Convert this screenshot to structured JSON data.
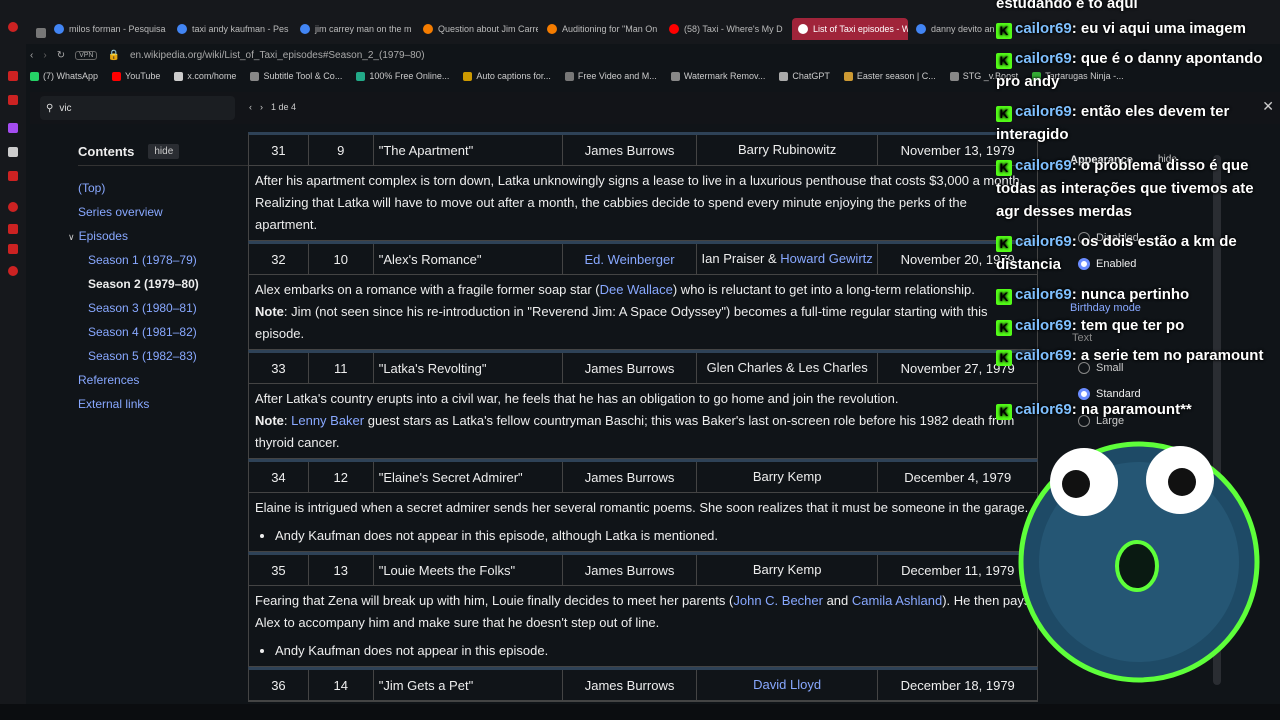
{
  "tabs": [
    {
      "title": "milos forman - Pesquisa",
      "color": "#4285f4"
    },
    {
      "title": "taxi andy kaufman - Pes",
      "color": "#4285f4"
    },
    {
      "title": "jim carrey man on the m",
      "color": "#4285f4"
    },
    {
      "title": "Question about Jim Carre",
      "color": "#f57c00"
    },
    {
      "title": "Auditioning for \"Man On",
      "color": "#f57c00"
    },
    {
      "title": "(58) Taxi - Where's My D",
      "color": "#ff0000"
    },
    {
      "title": "List of Taxi episodes - Wi",
      "color": "#ffffff"
    },
    {
      "title": "danny devito an",
      "color": "#4285f4"
    }
  ],
  "address": {
    "vpn": "VPN",
    "url": "en.wikipedia.org/wiki/List_of_Taxi_episodes#Season_2_(1979–80)"
  },
  "bookmarks": [
    "(7) WhatsApp",
    "YouTube",
    "x.com/home",
    "Subtitle Tool & Co...",
    "100% Free Online...",
    "Auto captions for...",
    "Free Video and M...",
    "Watermark Remov...",
    "ChatGPT",
    "Easter season | C...",
    "STG _v.Boost",
    "Tartarugas Ninja -..."
  ],
  "find": {
    "query": "vic",
    "count": "1 de 4"
  },
  "toc": {
    "title": "Contents",
    "hide": "hide",
    "items": [
      {
        "label": "(Top)",
        "level": 0
      },
      {
        "label": "Series overview",
        "level": 0
      },
      {
        "label": "Episodes",
        "level": 0
      },
      {
        "label": "Season 1 (1978–79)",
        "level": 1
      },
      {
        "label": "Season 2 (1979–80)",
        "level": 1,
        "current": true
      },
      {
        "label": "Season 3 (1980–81)",
        "level": 1
      },
      {
        "label": "Season 4 (1981–82)",
        "level": 1
      },
      {
        "label": "Season 5 (1982–83)",
        "level": 1
      },
      {
        "label": "References",
        "level": 0
      },
      {
        "label": "External links",
        "level": 0
      }
    ]
  },
  "episodes": [
    {
      "no": "31",
      "season": "9",
      "title": "\"The Apartment\"",
      "director": "James Burrows",
      "writer": "Barry Rubinowitz",
      "date": "November 13, 1979",
      "synopsis": "After his apartment complex is torn down, Latka unknowingly signs a lease to live in a luxurious penthouse that costs $3,000 a month. Realizing that Latka will have to move out after a month, the cabbies decide to spend every minute enjoying the perks of the apartment."
    },
    {
      "no": "32",
      "season": "10",
      "title": "\"Alex's Romance\"",
      "director": "Ed. Weinberger",
      "writer_a": "Ian Praiser &",
      "writer_b": "Howard Gewirtz",
      "date": "November 20, 1979",
      "syn_a": "Alex embarks on a romance with a fragile former soap star (",
      "syn_link": "Dee Wallace",
      "syn_b": ") who is reluctant to get into a long-term relationship.",
      "note_label": "Note",
      "note": ": Jim (not seen since his re-introduction in \"Reverend Jim: A Space Odyssey\") becomes a full-time regular starting with this episode."
    },
    {
      "no": "33",
      "season": "11",
      "title": "\"Latka's Revolting\"",
      "director": "James Burrows",
      "writer": "Glen Charles & Les Charles",
      "date": "November 27, 1979",
      "synopsis": "After Latka's country erupts into a civil war, he feels that he has an obligation to go home and join the revolution.",
      "note_label": "Note",
      "note_link": "Lenny Baker",
      "note": " guest stars as Latka's fellow countryman Baschi; this was Baker's last on-screen role before his 1982 death from thyroid cancer."
    },
    {
      "no": "34",
      "season": "12",
      "title": "\"Elaine's Secret Admirer\"",
      "director": "James Burrows",
      "writer": "Barry Kemp",
      "date": "December 4, 1979",
      "synopsis": "Elaine is intrigued when a secret admirer sends her several romantic poems. She soon realizes that it must be someone in the garage.",
      "bullet": "Andy Kaufman does not appear in this episode, although Latka is mentioned."
    },
    {
      "no": "35",
      "season": "13",
      "title": "\"Louie Meets the Folks\"",
      "director": "James Burrows",
      "writer": "Barry Kemp",
      "date": "December 11, 1979",
      "syn_a": "Fearing that Zena will break up with him, Louie finally decides to meet her parents (",
      "syn_link1": "John C. Becher",
      "syn_and": " and ",
      "syn_link2": "Camila Ashland",
      "syn_b": "). He then pays Alex to accompany him and make sure that he doesn't step out of line.",
      "bullet": "Andy Kaufman does not appear in this episode."
    },
    {
      "no": "36",
      "season": "14",
      "title": "\"Jim Gets a Pet\"",
      "director": "James Burrows",
      "writer": "David Lloyd",
      "date": "December 18, 1979"
    }
  ],
  "chat": [
    {
      "user": "",
      "text": "estudando e to aqui"
    },
    {
      "user": "cailor69",
      "text": "eu vi aqui uma imagem"
    },
    {
      "user": "cailor69",
      "text": "que é o danny apontando pro andy"
    },
    {
      "user": "cailor69",
      "text": "então eles devem ter interagido"
    },
    {
      "user": "cailor69",
      "text": "o problema disso é que todas as interações que tivemos ate agr desses merdas"
    },
    {
      "user": "cailor69",
      "text": "os dois estão a km de distancia"
    },
    {
      "user": "cailor69",
      "text": "nunca pertinho"
    },
    {
      "user": "cailor69",
      "text": "tem que ter po"
    },
    {
      "user": "cailor69",
      "text": "a serie tem no paramount"
    },
    {
      "user": "cailor69",
      "text": "na paramount**"
    }
  ],
  "appearance": {
    "title": "Appearance",
    "hide": "hide",
    "options": [
      "Disabled",
      "Enabled"
    ],
    "birthday": "Birthday mode",
    "text_label": "Text",
    "sizes": [
      "Small",
      "Standard",
      "Large"
    ]
  },
  "colors": {
    "link": "#88a8ff",
    "tab_active": "#a0243a",
    "kick": "#53fc18",
    "chat_user": "#7fc0ff"
  }
}
